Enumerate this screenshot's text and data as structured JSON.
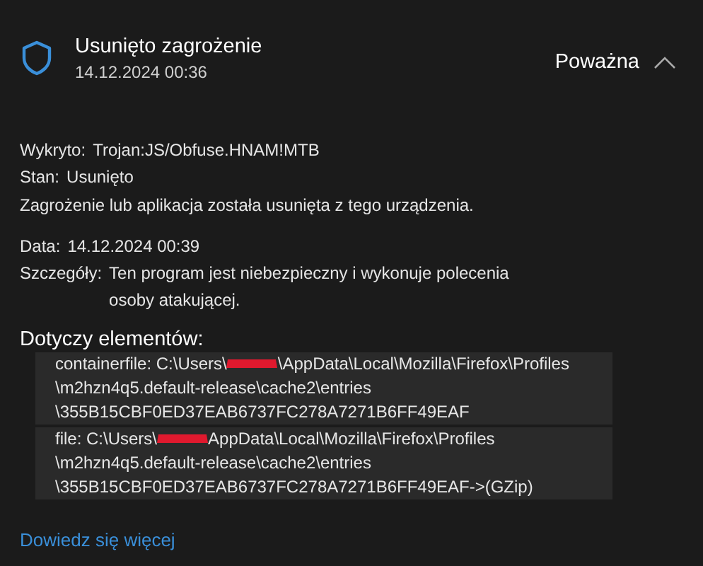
{
  "header": {
    "title": "Usunięto zagrożenie",
    "timestamp": "14.12.2024 00:36",
    "severity": "Poważna",
    "expanded": true
  },
  "details": [
    {
      "label": "Wykryto:",
      "value": "Trojan:JS/Obfuse.HNAM!MTB"
    },
    {
      "label": "Stan:",
      "value": "Usunięto"
    }
  ],
  "note": "Zagrożenie lub aplikacja została usunięta z tego urządzenia.",
  "details_2": [
    {
      "label": "Data:",
      "value": "14.12.2024 00:39"
    },
    {
      "label": "Szczegóły:",
      "value": "Ten program jest niebezpieczny i wykonuje polecenia osoby atakującej."
    }
  ],
  "affected": {
    "title": "Dotyczy elementów:",
    "items": [
      {
        "first_line_start": "containerfile: C:\\Users\\",
        "first_line_end": "\\AppData\\Local\\Mozilla\\Firefox\\Profiles",
        "more_lines": [
          "\\m2hzn4q5.default-release\\cache2\\entries",
          "\\355B15CBF0ED37EAB6737FC278A7271B6FF49EAF"
        ]
      },
      {
        "first_line_start": "file: C:\\Users\\",
        "first_line_end": "AppData\\Local\\Mozilla\\Firefox\\Profiles",
        "more_lines": [
          "\\m2hzn4q5.default-release\\cache2\\entries",
          "\\355B15CBF0ED37EAB6737FC278A7271B6FF49EAF->(GZip)"
        ]
      }
    ]
  },
  "link": "Dowiedz się więcej"
}
